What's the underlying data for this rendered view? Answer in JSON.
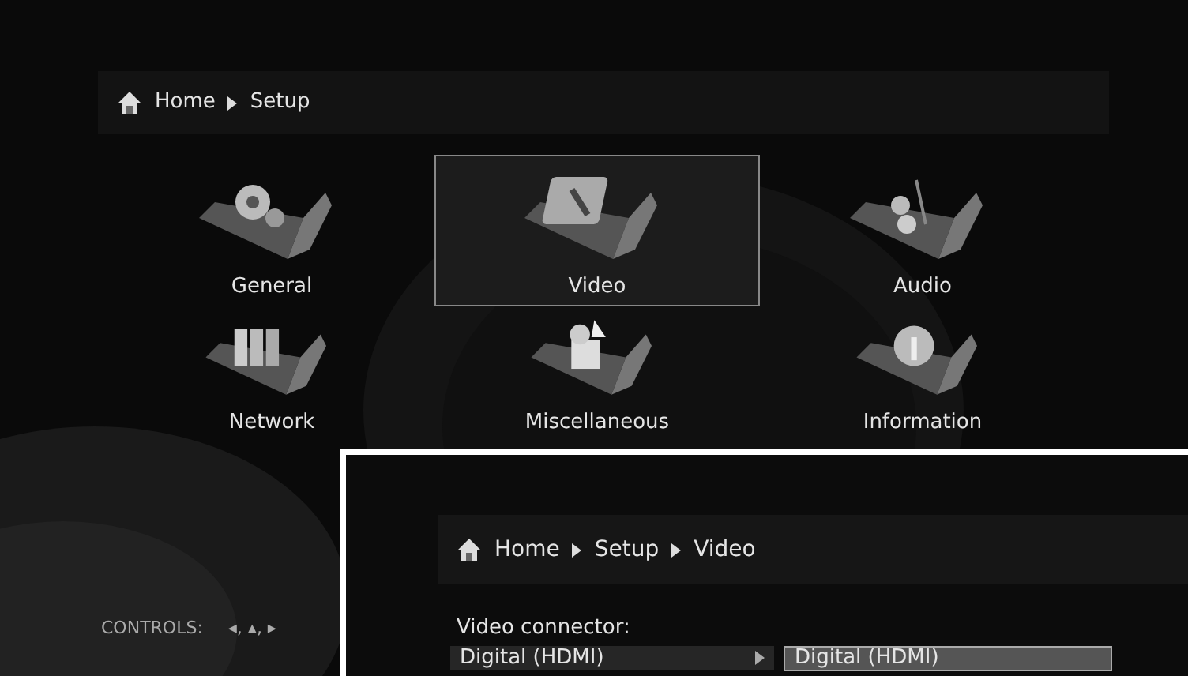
{
  "main_screen": {
    "breadcrumb": [
      "Home",
      "Setup"
    ],
    "menu_items": [
      {
        "label": "General",
        "selected": false
      },
      {
        "label": "Video",
        "selected": true
      },
      {
        "label": "Audio",
        "selected": false
      },
      {
        "label": "Network",
        "selected": false
      },
      {
        "label": "Miscellaneous",
        "selected": false
      },
      {
        "label": "Information",
        "selected": false
      }
    ],
    "controls": {
      "label": "CONTROLS:",
      "keys": "◂, ▴, ▸"
    }
  },
  "inset_screen": {
    "breadcrumb": [
      "Home",
      "Setup",
      "Video"
    ],
    "setting": {
      "label": "Video connector:",
      "value": "Digital (HDMI)",
      "option": "Digital (HDMI)"
    }
  }
}
